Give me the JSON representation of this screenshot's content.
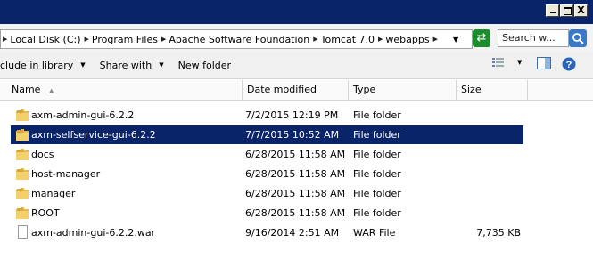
{
  "window": {
    "minimize": "",
    "close": "X"
  },
  "address": {
    "crumbs": [
      {
        "label": "Local Disk (C:)"
      },
      {
        "label": "Program Files"
      },
      {
        "label": "Apache Software Foundation"
      },
      {
        "label": "Tomcat 7.0"
      },
      {
        "label": "webapps"
      }
    ],
    "search_placeholder": "Search w..."
  },
  "toolbar": {
    "include_label": "clude in library",
    "share_label": "Share with",
    "new_folder_label": "New folder"
  },
  "columns": {
    "name": "Name",
    "date": "Date modified",
    "type": "Type",
    "size": "Size"
  },
  "files": [
    {
      "name": "axm-admin-gui-6.2.2",
      "date": "7/2/2015 12:19 PM",
      "type": "File folder",
      "size": "",
      "kind": "folder",
      "selected": false
    },
    {
      "name": "axm-selfservice-gui-6.2.2",
      "date": "7/7/2015 10:52 AM",
      "type": "File folder",
      "size": "",
      "kind": "folder",
      "selected": true
    },
    {
      "name": "docs",
      "date": "6/28/2015 11:58 AM",
      "type": "File folder",
      "size": "",
      "kind": "folder",
      "selected": false
    },
    {
      "name": "host-manager",
      "date": "6/28/2015 11:58 AM",
      "type": "File folder",
      "size": "",
      "kind": "folder",
      "selected": false
    },
    {
      "name": "manager",
      "date": "6/28/2015 11:58 AM",
      "type": "File folder",
      "size": "",
      "kind": "folder",
      "selected": false
    },
    {
      "name": "ROOT",
      "date": "6/28/2015 11:58 AM",
      "type": "File folder",
      "size": "",
      "kind": "folder",
      "selected": false
    },
    {
      "name": "axm-admin-gui-6.2.2.war",
      "date": "9/16/2014 2:51 AM",
      "type": "WAR File",
      "size": "7,735 KB",
      "kind": "file",
      "selected": false
    }
  ],
  "colors": {
    "titlebar": "#0a246a",
    "selection": "#0a246a",
    "folder": "#e8b84a"
  }
}
